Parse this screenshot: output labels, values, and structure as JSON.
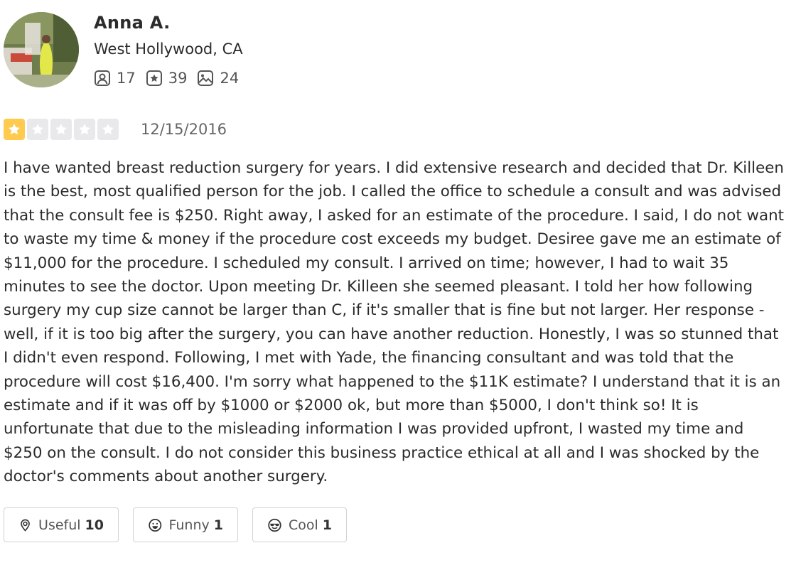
{
  "user": {
    "name": "Anna A.",
    "location": "West Hollywood, CA",
    "stats": {
      "friends": "17",
      "reviews": "39",
      "photos": "24"
    }
  },
  "review": {
    "rating": 1,
    "max_rating": 5,
    "date": "12/15/2016",
    "text": "I have wanted breast reduction surgery for years. I did extensive research and decided that Dr. Killeen is the best, most qualified person for the job. I called the office to schedule a consult and was advised that the consult fee is $250. Right away, I asked for an estimate of the procedure. I said, I do not want to waste my time & money if the procedure cost exceeds my budget. Desiree gave me an estimate of $11,000 for the procedure. I scheduled my consult. I arrived on time; however, I had to wait 35 minutes to see the doctor. Upon meeting Dr. Killeen she seemed pleasant. I told her how following surgery my cup size cannot be larger than C, if it's smaller that is fine but not larger. Her response - well, if it is too big after the surgery, you can have another reduction. Honestly, I was so stunned that I didn't even respond. Following, I met with Yade, the financing consultant and was told that the procedure will cost $16,400. I'm sorry what happened to the $11K estimate? I understand that it is an estimate and if it was off by $1000 or $2000 ok, but more than $5000, I don't think so! It is unfortunate that due to the misleading information I was provided upfront, I wasted my time and $250 on the consult. I do not consider this business practice ethical at all and I was shocked by the doctor's comments about another surgery."
  },
  "votes": {
    "useful": {
      "label": "Useful",
      "count": "10",
      "icon": "lightbulb-icon"
    },
    "funny": {
      "label": "Funny",
      "count": "1",
      "icon": "smile-icon"
    },
    "cool": {
      "label": "Cool",
      "count": "1",
      "icon": "sunglasses-icon"
    }
  },
  "colors": {
    "star_filled": "#ffcb4f",
    "star_empty": "#e9e9eb",
    "text": "#2b2b2b"
  }
}
